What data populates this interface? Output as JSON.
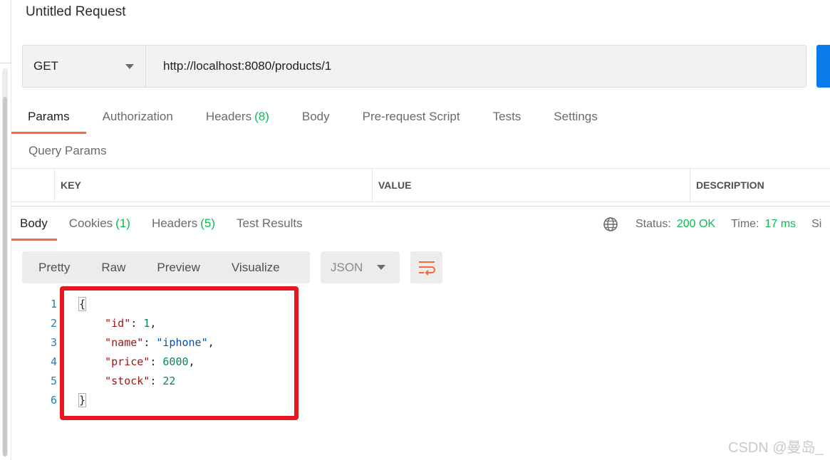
{
  "request": {
    "title": "Untitled Request",
    "method": "GET",
    "url": "http://localhost:8080/products/1"
  },
  "request_tabs": [
    {
      "label": "Params",
      "count": "",
      "active": true
    },
    {
      "label": "Authorization",
      "count": "",
      "active": false
    },
    {
      "label": "Headers",
      "count": "(8)",
      "active": false
    },
    {
      "label": "Body",
      "count": "",
      "active": false
    },
    {
      "label": "Pre-request Script",
      "count": "",
      "active": false
    },
    {
      "label": "Tests",
      "count": "",
      "active": false
    },
    {
      "label": "Settings",
      "count": "",
      "active": false
    }
  ],
  "query_params": {
    "title": "Query Params",
    "columns": [
      "KEY",
      "VALUE",
      "DESCRIPTION"
    ]
  },
  "response_tabs": [
    {
      "label": "Body",
      "count": "",
      "active": true
    },
    {
      "label": "Cookies",
      "count": "(1)",
      "active": false
    },
    {
      "label": "Headers",
      "count": "(5)",
      "active": false
    },
    {
      "label": "Test Results",
      "count": "",
      "active": false
    }
  ],
  "response_status": {
    "status_label": "Status:",
    "status_value": "200 OK",
    "time_label": "Time:",
    "time_value": "17 ms",
    "size_label": "Si"
  },
  "view_modes": [
    "Pretty",
    "Raw",
    "Preview",
    "Visualize"
  ],
  "format": "JSON",
  "code_lines": [
    "1",
    "2",
    "3",
    "4",
    "5",
    "6"
  ],
  "json_body": {
    "open_brace": "{",
    "close_brace": "}",
    "fields": [
      {
        "key": "\"id\"",
        "value": "1",
        "type": "number",
        "trail": ","
      },
      {
        "key": "\"name\"",
        "value": "\"iphone\"",
        "type": "string",
        "trail": ","
      },
      {
        "key": "\"price\"",
        "value": "6000",
        "type": "number",
        "trail": ","
      },
      {
        "key": "\"stock\"",
        "value": "22",
        "type": "number",
        "trail": ""
      }
    ]
  },
  "watermark": "CSDN @曼岛_",
  "colors": {
    "accent_tab": "#f26b3a",
    "success_green": "#0cbb52",
    "send_blue": "#097bed",
    "highlight_red": "#e8161e"
  },
  "icons": [
    "caret-down-icon",
    "globe-icon",
    "wrap-lines-icon"
  ]
}
